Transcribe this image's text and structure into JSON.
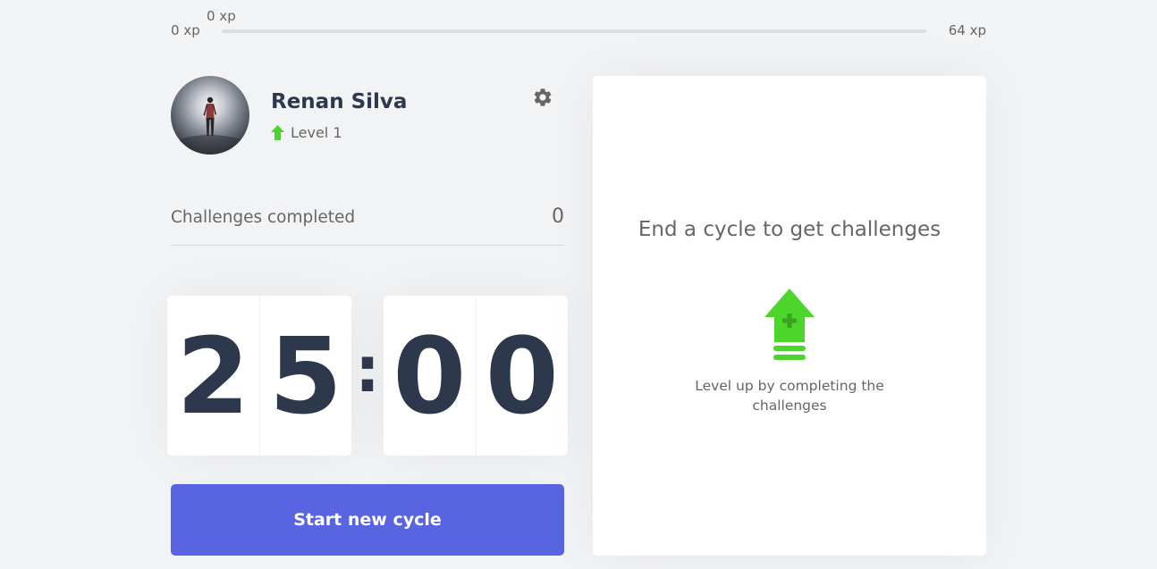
{
  "xp": {
    "min_label": "0 xp",
    "max_label": "64 xp",
    "current_label": "0 xp",
    "progress_percent": 0
  },
  "profile": {
    "name": "Renan Silva",
    "level_label": "Level 1"
  },
  "stats": {
    "challenges_label": "Challenges completed",
    "challenges_count": "0"
  },
  "countdown": {
    "minute_left": "2",
    "minute_right": "5",
    "separator": ":",
    "second_left": "0",
    "second_right": "0"
  },
  "actions": {
    "start_label": "Start new cycle"
  },
  "challenge": {
    "title": "End a cycle to get challenges",
    "subtitle": "Level up by completing the challenges"
  },
  "icons": {
    "gear": "gear-icon",
    "level": "level-up-arrow-icon",
    "levelup": "level-up-arrow-icon"
  },
  "colors": {
    "accent": "#5965e0",
    "green": "#4cd62b",
    "title": "#2e384d",
    "text": "#666666",
    "background": "#f2f3f5"
  }
}
